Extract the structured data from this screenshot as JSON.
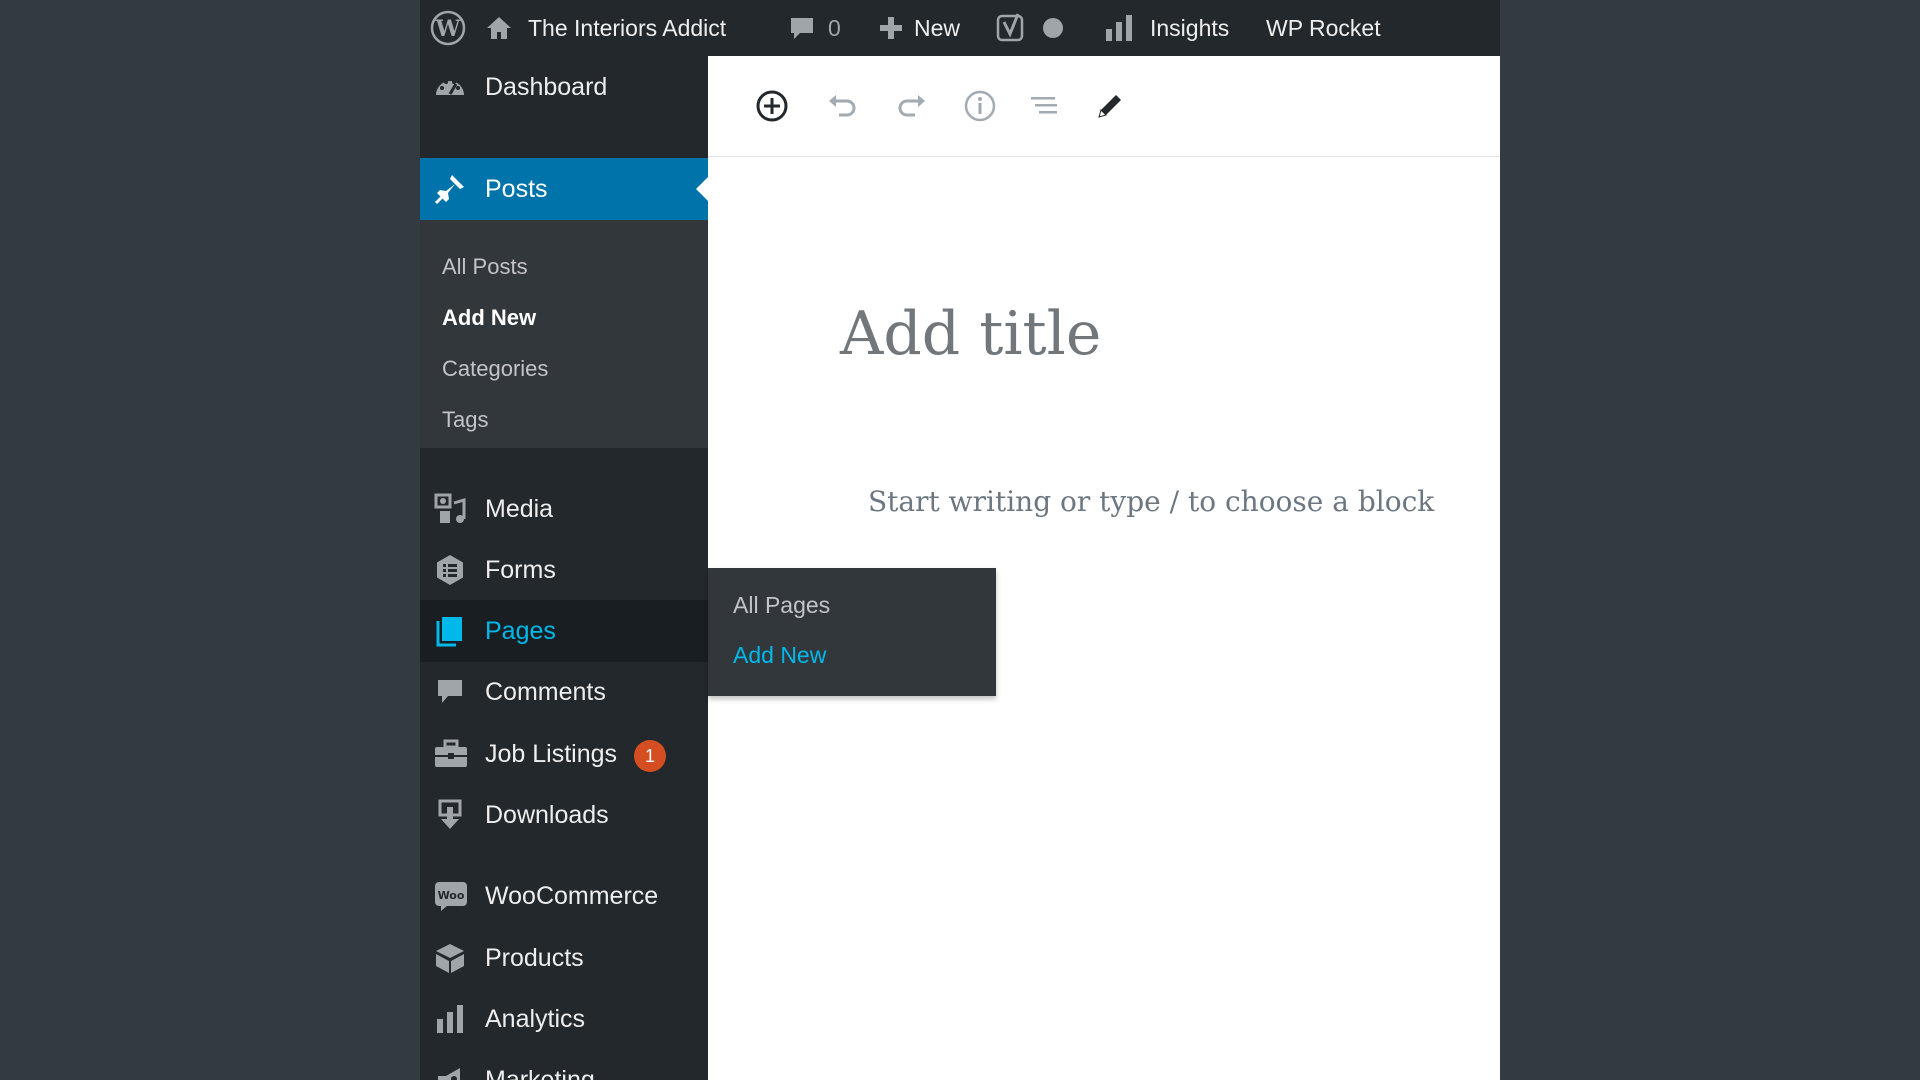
{
  "adminbar": {
    "site_name": "The Interiors Addict",
    "comments_count": "0",
    "new_label": "New",
    "insights_label": "Insights",
    "wprocket_label": "WP Rocket",
    "icons": [
      "wordpress-logo-icon",
      "home-icon",
      "comment-bubble-icon",
      "plus-icon",
      "yoast-icon",
      "status-dot-icon",
      "bar-chart-icon"
    ]
  },
  "sidebar": {
    "dashboard": "Dashboard",
    "posts": "Posts",
    "posts_submenu": [
      "All Posts",
      "Add New",
      "Categories",
      "Tags"
    ],
    "media": "Media",
    "forms": "Forms",
    "pages": "Pages",
    "comments": "Comments",
    "job_listings": "Job Listings",
    "job_listings_badge": "1",
    "downloads": "Downloads",
    "woocommerce": "WooCommerce",
    "woocommerce_icon_text": "Woo",
    "products": "Products",
    "analytics": "Analytics",
    "marketing": "Marketing"
  },
  "pages_flyout": {
    "items": [
      "All Pages",
      "Add New"
    ]
  },
  "editor": {
    "toolbar_icons": [
      "add-block-icon",
      "undo-icon",
      "redo-icon",
      "info-icon",
      "outline-icon",
      "edit-pencil-icon"
    ],
    "title_placeholder": "Add title",
    "block_placeholder": "Start writing or type / to choose a block"
  },
  "colors": {
    "admin_dark": "#23282d",
    "submenu_bg": "#32373c",
    "active_blue": "#0073aa",
    "highlight_cyan": "#00b9eb",
    "badge_orange": "#d54e21",
    "backdrop": "#343a42"
  }
}
